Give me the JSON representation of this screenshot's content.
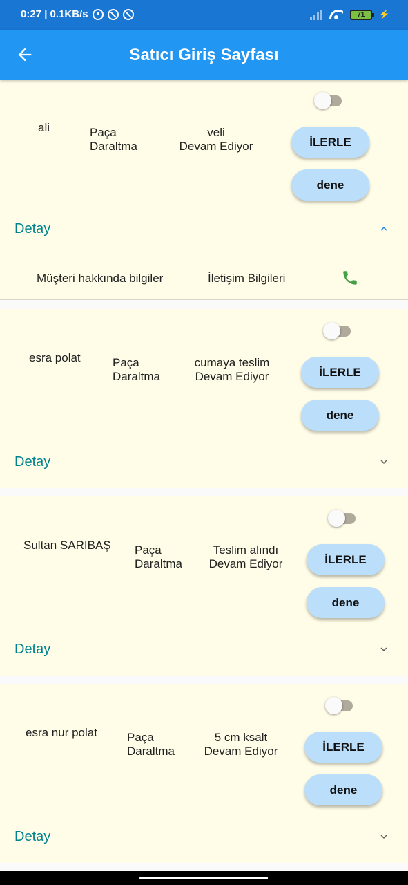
{
  "status_bar": {
    "text": "0:27 | 0.1KB/s",
    "battery": "71",
    "icons": [
      "alarm-icon",
      "blocked-icon",
      "blocked-icon",
      "signal-icon",
      "wifi-icon",
      "battery-icon",
      "charging-icon"
    ]
  },
  "app_bar": {
    "title": "Satıcı Giriş Sayfası",
    "back_icon": "arrow-left-icon",
    "color": "#2196f3"
  },
  "colors": {
    "card_background": "#fffde7",
    "button_background": "#bbdefb",
    "detay_text": "#00838f",
    "phone_icon": "#43a047"
  },
  "orders": [
    {
      "customer": "ali",
      "operation": "Paça\nDaraltma",
      "note": "veli\nDevam Ediyor",
      "toggle_on": false,
      "primary_button": "İLERLE",
      "secondary_button": "dene",
      "detay_label": "Detay",
      "expanded": true,
      "details": {
        "customer_info": "Müşteri hakkında bilgiler",
        "contact_info": "İletişim Bilgileri",
        "icon": "phone-icon"
      }
    },
    {
      "customer": "esra polat",
      "operation": "Paça\nDaraltma",
      "note": "cumaya teslim\nDevam Ediyor",
      "toggle_on": false,
      "primary_button": "İLERLE",
      "secondary_button": "dene",
      "detay_label": "Detay",
      "expanded": false
    },
    {
      "customer": "Sultan SARIBAŞ",
      "operation": "Paça\nDaraltma",
      "note": "Teslim alındı\nDevam Ediyor",
      "toggle_on": false,
      "primary_button": "İLERLE",
      "secondary_button": "dene",
      "detay_label": "Detay",
      "expanded": false
    },
    {
      "customer": "esra nur polat",
      "operation": "Paça\nDaraltma",
      "note": "5 cm ksalt\nDevam Ediyor",
      "toggle_on": false,
      "primary_button": "İLERLE",
      "secondary_button": "dene",
      "detay_label": "Detay",
      "expanded": false
    }
  ]
}
